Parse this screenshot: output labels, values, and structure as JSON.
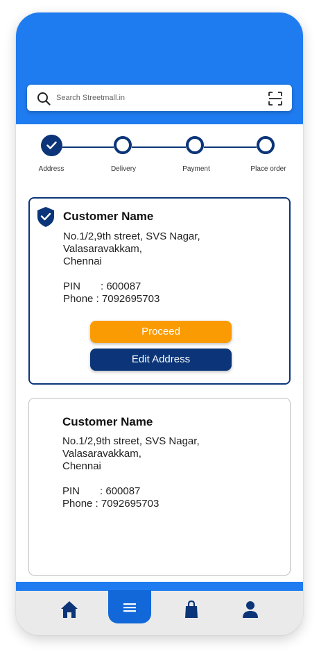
{
  "search": {
    "placeholder": "Search Streetmall.in"
  },
  "stepper": {
    "steps": [
      {
        "label": "Address",
        "state": "completed"
      },
      {
        "label": "Delivery",
        "state": "pending"
      },
      {
        "label": "Payment",
        "state": "pending"
      },
      {
        "label": "Place order",
        "state": "pending"
      }
    ]
  },
  "addresses": [
    {
      "name": "Customer Name",
      "line1": "No.1/2,9th street, SVS Nagar,",
      "line2": "Valasaravakkam,",
      "line3": "Chennai",
      "pin_label": "PIN",
      "pin": ": 600087",
      "phone_label": "Phone",
      "phone": ": 7092695703",
      "selected": true,
      "proceed_label": "Proceed",
      "edit_label": "Edit Address"
    },
    {
      "name": "Customer Name",
      "line1": "No.1/2,9th street, SVS Nagar,",
      "line2": "Valasaravakkam,",
      "line3": "Chennai",
      "pin_label": "PIN",
      "pin": ": 600087",
      "phone_label": "Phone",
      "phone": ": 7092695703",
      "selected": false
    }
  ],
  "bottom_nav": {
    "items": [
      {
        "icon": "home-icon"
      },
      {
        "icon": "menu-icon",
        "active": true
      },
      {
        "icon": "shopping-bag-icon"
      },
      {
        "icon": "user-icon"
      }
    ]
  },
  "colors": {
    "primary_blue": "#1f7cf0",
    "navy": "#0b3578",
    "orange": "#fb9b04"
  }
}
